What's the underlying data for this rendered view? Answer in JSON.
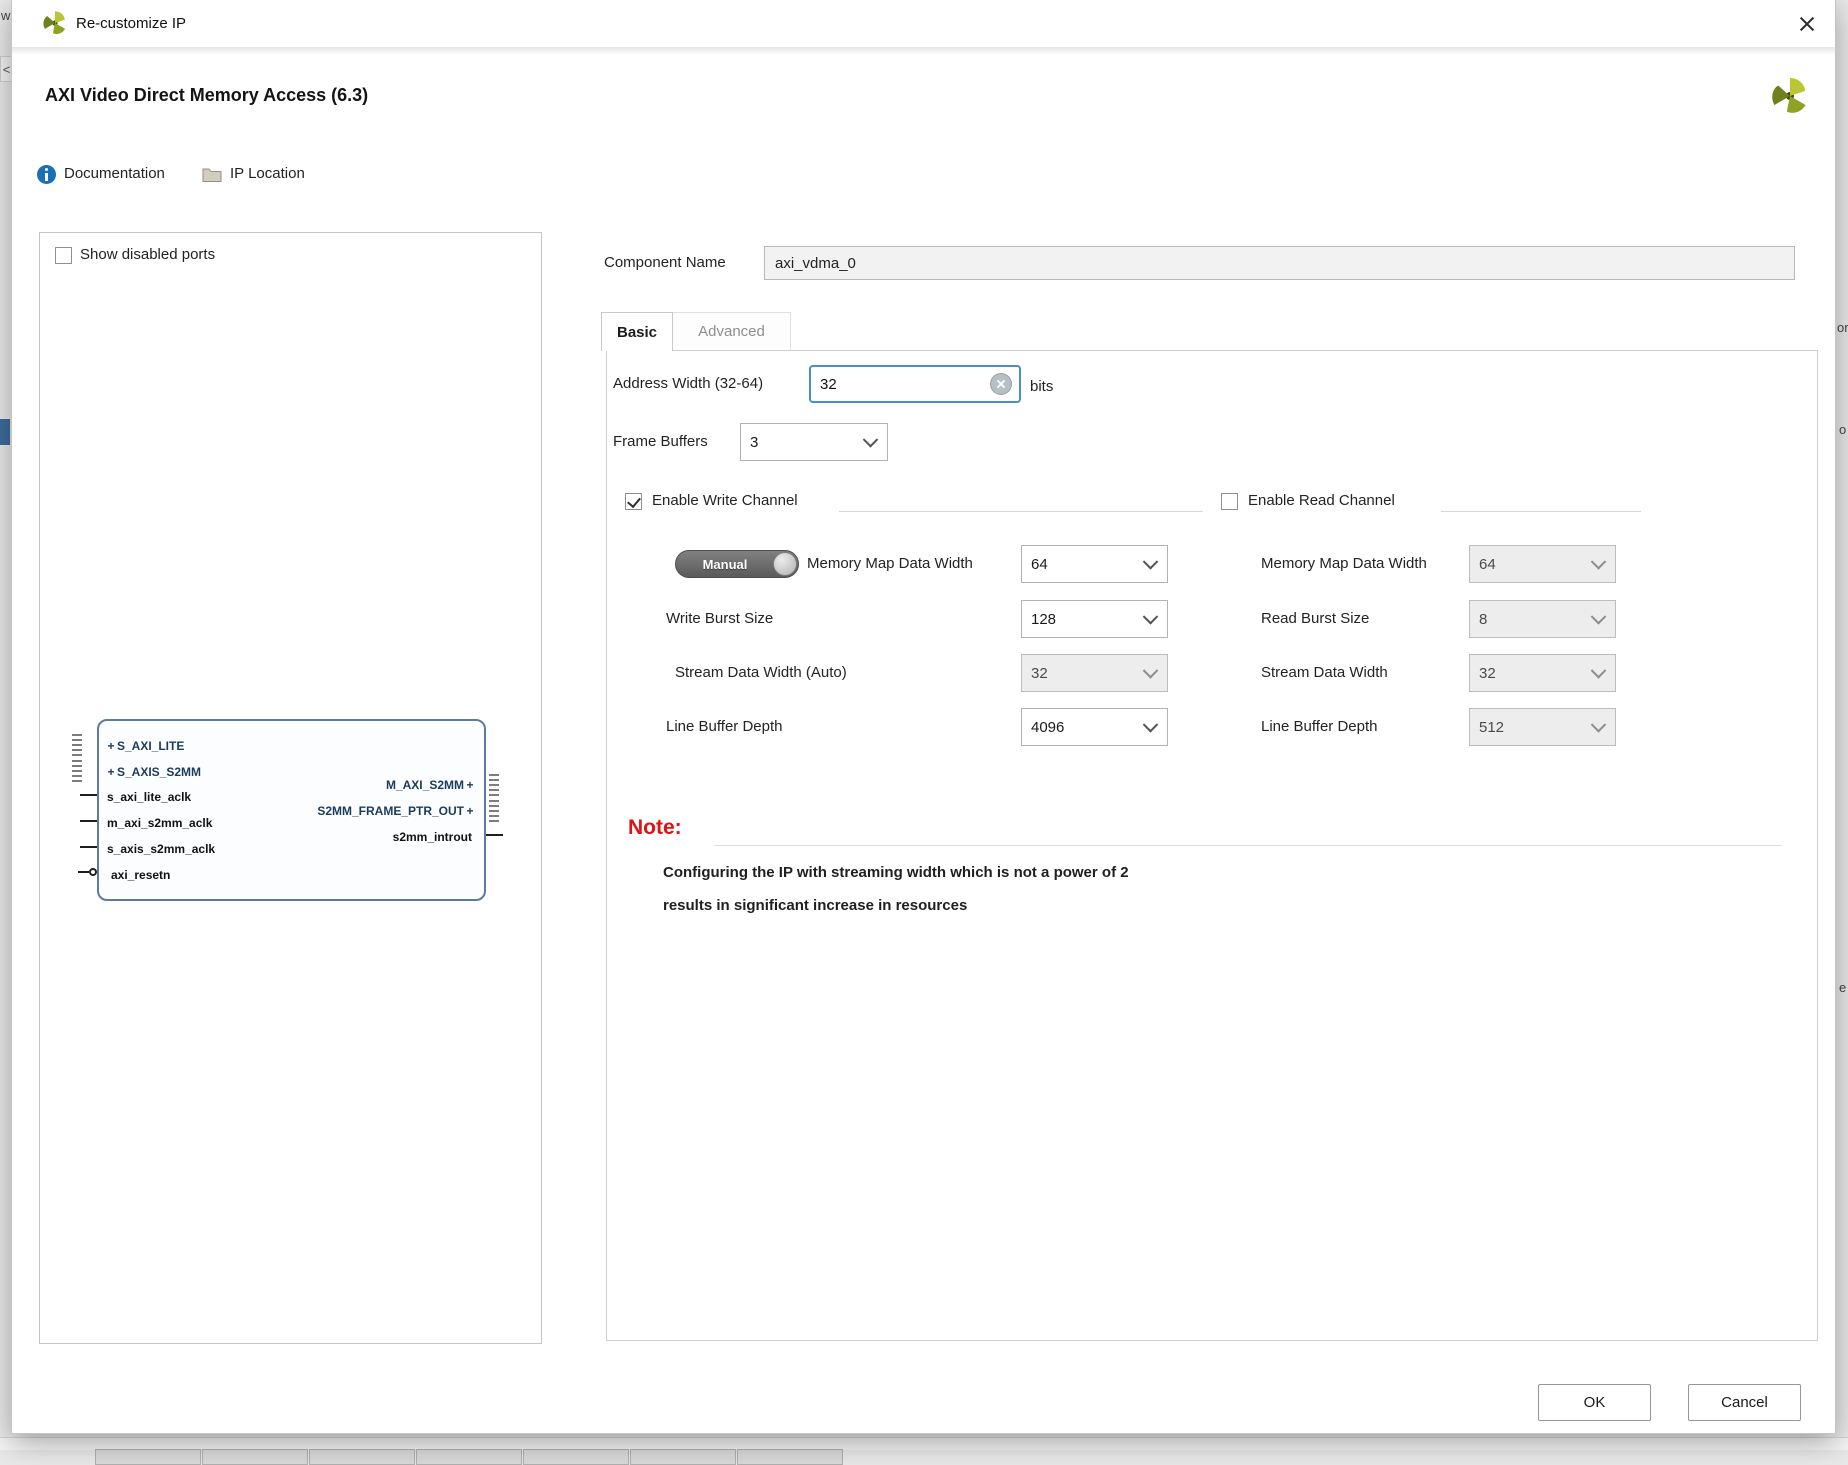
{
  "window": {
    "title": "Re-customize IP"
  },
  "header": {
    "title": "AXI Video Direct Memory Access (6.3)"
  },
  "links": {
    "documentation": "Documentation",
    "ip_location": "IP Location"
  },
  "left_panel": {
    "show_disabled_ports": "Show disabled ports",
    "block": {
      "left_ports": [
        {
          "label": "S_AXI_LITE",
          "type": "interface"
        },
        {
          "label": "S_AXIS_S2MM",
          "type": "interface"
        },
        {
          "label": "s_axi_lite_aclk",
          "type": "clock"
        },
        {
          "label": "m_axi_s2mm_aclk",
          "type": "clock"
        },
        {
          "label": "s_axis_s2mm_aclk",
          "type": "clock"
        },
        {
          "label": "axi_resetn",
          "type": "reset"
        }
      ],
      "right_ports": [
        {
          "label": "M_AXI_S2MM",
          "type": "interface"
        },
        {
          "label": "S2MM_FRAME_PTR_OUT",
          "type": "interface"
        },
        {
          "label": "s2mm_introut",
          "type": "signal"
        }
      ]
    }
  },
  "component": {
    "label": "Component Name",
    "value": "axi_vdma_0"
  },
  "tabs": [
    {
      "label": "Basic",
      "active": true
    },
    {
      "label": "Advanced",
      "active": false
    }
  ],
  "basic": {
    "address_width": {
      "label": "Address Width (32-64)",
      "value": "32",
      "suffix": "bits"
    },
    "frame_buffers": {
      "label": "Frame Buffers",
      "value": "3"
    },
    "write_channel": {
      "enable_label": "Enable Write Channel",
      "enabled": true,
      "manual_label": "Manual",
      "rows": [
        {
          "label": "Memory Map Data Width",
          "value": "64",
          "disabled": false
        },
        {
          "label": "Write Burst Size",
          "value": "128",
          "disabled": false
        },
        {
          "label": "Stream Data Width (Auto)",
          "value": "32",
          "disabled": true
        },
        {
          "label": "Line Buffer Depth",
          "value": "4096",
          "disabled": false
        }
      ]
    },
    "read_channel": {
      "enable_label": "Enable Read Channel",
      "enabled": false,
      "rows": [
        {
          "label": "Memory Map Data Width",
          "value": "64",
          "disabled": true
        },
        {
          "label": "Read Burst Size",
          "value": "8",
          "disabled": true
        },
        {
          "label": "Stream Data Width",
          "value": "32",
          "disabled": true
        },
        {
          "label": "Line Buffer Depth",
          "value": "512",
          "disabled": true
        }
      ]
    },
    "note": {
      "title": "Note:",
      "lines": [
        "Configuring the IP with streaming width which is not a power of 2",
        "results in significant increase in resources"
      ]
    }
  },
  "footer": {
    "ok": "OK",
    "cancel": "Cancel"
  },
  "colors": {
    "accent_blue": "#4a90c8",
    "note_red": "#e01212",
    "logo_green": "#b9c733"
  },
  "background_fragments": {
    "top_left": "w",
    "collapse_button": "<",
    "right_edge_1": "or",
    "right_edge_2": "o",
    "right_edge_3": "e"
  }
}
